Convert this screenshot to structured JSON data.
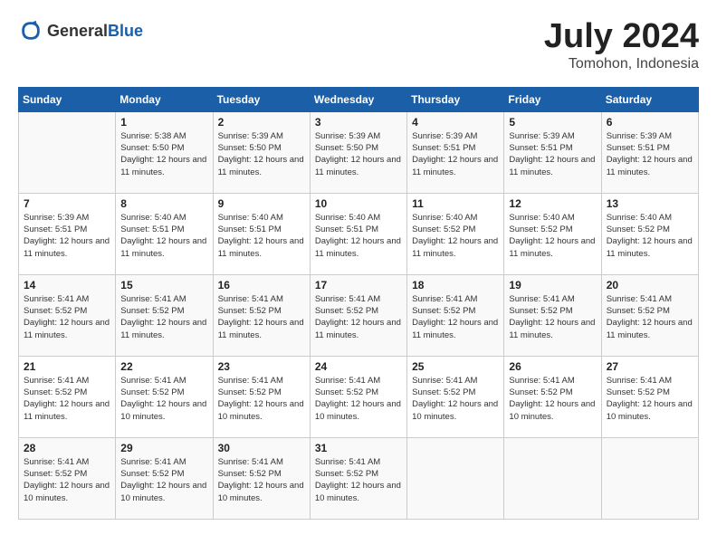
{
  "header": {
    "logo_general": "General",
    "logo_blue": "Blue",
    "month_year": "July 2024",
    "location": "Tomohon, Indonesia"
  },
  "days_of_week": [
    "Sunday",
    "Monday",
    "Tuesday",
    "Wednesday",
    "Thursday",
    "Friday",
    "Saturday"
  ],
  "weeks": [
    [
      {
        "day": "",
        "info": ""
      },
      {
        "day": "1",
        "info": "Sunrise: 5:38 AM\nSunset: 5:50 PM\nDaylight: 12 hours\nand 11 minutes."
      },
      {
        "day": "2",
        "info": "Sunrise: 5:39 AM\nSunset: 5:50 PM\nDaylight: 12 hours\nand 11 minutes."
      },
      {
        "day": "3",
        "info": "Sunrise: 5:39 AM\nSunset: 5:50 PM\nDaylight: 12 hours\nand 11 minutes."
      },
      {
        "day": "4",
        "info": "Sunrise: 5:39 AM\nSunset: 5:51 PM\nDaylight: 12 hours\nand 11 minutes."
      },
      {
        "day": "5",
        "info": "Sunrise: 5:39 AM\nSunset: 5:51 PM\nDaylight: 12 hours\nand 11 minutes."
      },
      {
        "day": "6",
        "info": "Sunrise: 5:39 AM\nSunset: 5:51 PM\nDaylight: 12 hours\nand 11 minutes."
      }
    ],
    [
      {
        "day": "7",
        "info": "Sunrise: 5:39 AM\nSunset: 5:51 PM\nDaylight: 12 hours\nand 11 minutes."
      },
      {
        "day": "8",
        "info": "Sunrise: 5:40 AM\nSunset: 5:51 PM\nDaylight: 12 hours\nand 11 minutes."
      },
      {
        "day": "9",
        "info": "Sunrise: 5:40 AM\nSunset: 5:51 PM\nDaylight: 12 hours\nand 11 minutes."
      },
      {
        "day": "10",
        "info": "Sunrise: 5:40 AM\nSunset: 5:51 PM\nDaylight: 12 hours\nand 11 minutes."
      },
      {
        "day": "11",
        "info": "Sunrise: 5:40 AM\nSunset: 5:52 PM\nDaylight: 12 hours\nand 11 minutes."
      },
      {
        "day": "12",
        "info": "Sunrise: 5:40 AM\nSunset: 5:52 PM\nDaylight: 12 hours\nand 11 minutes."
      },
      {
        "day": "13",
        "info": "Sunrise: 5:40 AM\nSunset: 5:52 PM\nDaylight: 12 hours\nand 11 minutes."
      }
    ],
    [
      {
        "day": "14",
        "info": "Sunrise: 5:41 AM\nSunset: 5:52 PM\nDaylight: 12 hours\nand 11 minutes."
      },
      {
        "day": "15",
        "info": "Sunrise: 5:41 AM\nSunset: 5:52 PM\nDaylight: 12 hours\nand 11 minutes."
      },
      {
        "day": "16",
        "info": "Sunrise: 5:41 AM\nSunset: 5:52 PM\nDaylight: 12 hours\nand 11 minutes."
      },
      {
        "day": "17",
        "info": "Sunrise: 5:41 AM\nSunset: 5:52 PM\nDaylight: 12 hours\nand 11 minutes."
      },
      {
        "day": "18",
        "info": "Sunrise: 5:41 AM\nSunset: 5:52 PM\nDaylight: 12 hours\nand 11 minutes."
      },
      {
        "day": "19",
        "info": "Sunrise: 5:41 AM\nSunset: 5:52 PM\nDaylight: 12 hours\nand 11 minutes."
      },
      {
        "day": "20",
        "info": "Sunrise: 5:41 AM\nSunset: 5:52 PM\nDaylight: 12 hours\nand 11 minutes."
      }
    ],
    [
      {
        "day": "21",
        "info": "Sunrise: 5:41 AM\nSunset: 5:52 PM\nDaylight: 12 hours\nand 11 minutes."
      },
      {
        "day": "22",
        "info": "Sunrise: 5:41 AM\nSunset: 5:52 PM\nDaylight: 12 hours\nand 10 minutes."
      },
      {
        "day": "23",
        "info": "Sunrise: 5:41 AM\nSunset: 5:52 PM\nDaylight: 12 hours\nand 10 minutes."
      },
      {
        "day": "24",
        "info": "Sunrise: 5:41 AM\nSunset: 5:52 PM\nDaylight: 12 hours\nand 10 minutes."
      },
      {
        "day": "25",
        "info": "Sunrise: 5:41 AM\nSunset: 5:52 PM\nDaylight: 12 hours\nand 10 minutes."
      },
      {
        "day": "26",
        "info": "Sunrise: 5:41 AM\nSunset: 5:52 PM\nDaylight: 12 hours\nand 10 minutes."
      },
      {
        "day": "27",
        "info": "Sunrise: 5:41 AM\nSunset: 5:52 PM\nDaylight: 12 hours\nand 10 minutes."
      }
    ],
    [
      {
        "day": "28",
        "info": "Sunrise: 5:41 AM\nSunset: 5:52 PM\nDaylight: 12 hours\nand 10 minutes."
      },
      {
        "day": "29",
        "info": "Sunrise: 5:41 AM\nSunset: 5:52 PM\nDaylight: 12 hours\nand 10 minutes."
      },
      {
        "day": "30",
        "info": "Sunrise: 5:41 AM\nSunset: 5:52 PM\nDaylight: 12 hours\nand 10 minutes."
      },
      {
        "day": "31",
        "info": "Sunrise: 5:41 AM\nSunset: 5:52 PM\nDaylight: 12 hours\nand 10 minutes."
      },
      {
        "day": "",
        "info": ""
      },
      {
        "day": "",
        "info": ""
      },
      {
        "day": "",
        "info": ""
      }
    ]
  ]
}
